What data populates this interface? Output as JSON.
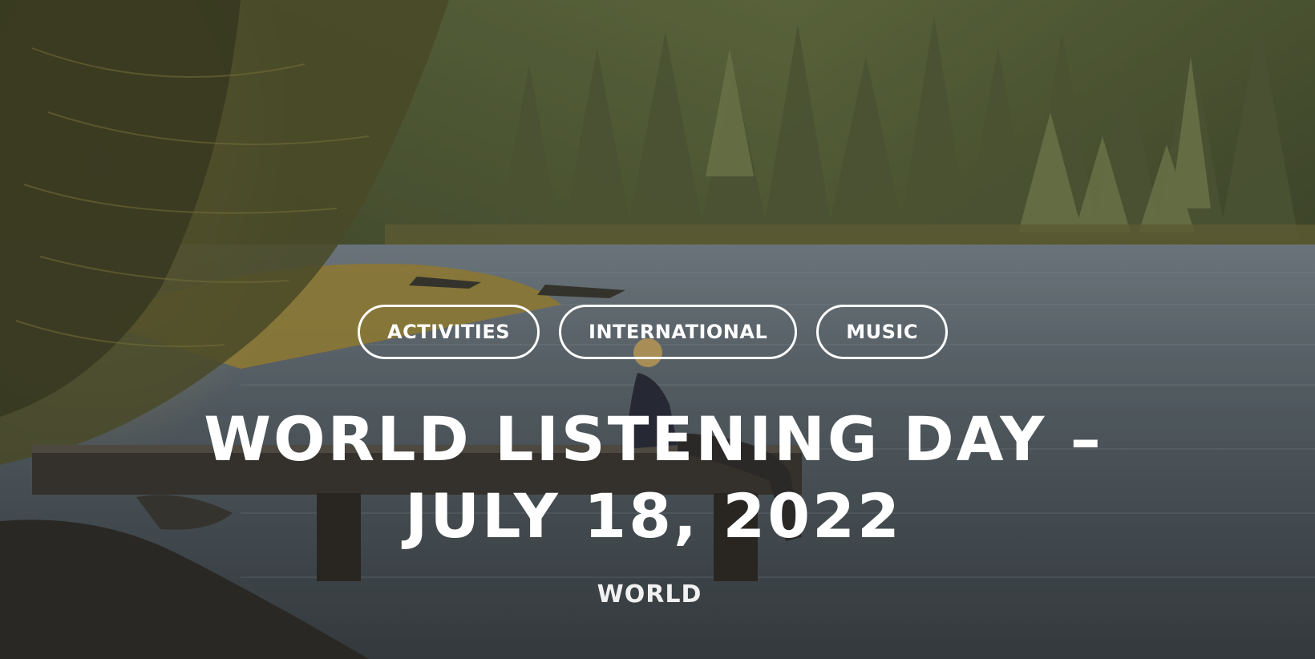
{
  "hero": {
    "image_description_icon": "lake-forest-photo",
    "tags": [
      {
        "label": "ACTIVITIES"
      },
      {
        "label": "INTERNATIONAL"
      },
      {
        "label": "MUSIC"
      }
    ],
    "title": "WORLD LISTENING DAY – JULY 18, 2022",
    "category": "WORLD"
  },
  "colors": {
    "text": "#ffffff",
    "tag_border": "#ffffff"
  }
}
